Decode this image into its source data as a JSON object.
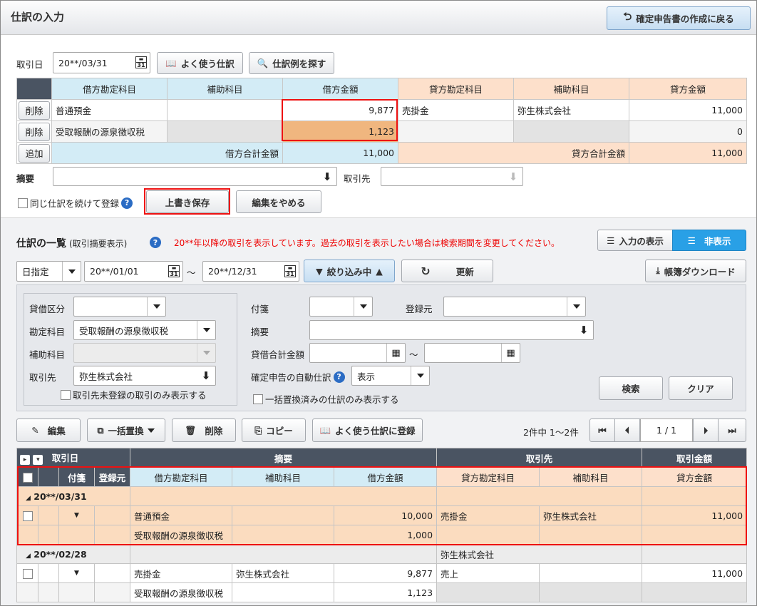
{
  "header": {
    "title": "仕訳の入力",
    "back_button": "確定申告書の作成に戻る"
  },
  "entry": {
    "date_label": "取引日",
    "date_value": "20**/03/31",
    "frequent_btn": "よく使う仕訳",
    "search_example_btn": "仕訳例を探す",
    "headers": [
      "借方勘定科目",
      "補助科目",
      "借方金額",
      "貸方勘定科目",
      "補助科目",
      "貸方金額"
    ],
    "rows": [
      {
        "action": "削除",
        "debit_account": "普通預金",
        "debit_sub": "",
        "debit_amount": "9,877",
        "credit_account": "売掛金",
        "credit_sub": "弥生株式会社",
        "credit_amount": "11,000"
      },
      {
        "action": "削除",
        "debit_account": "受取報酬の源泉徴収税",
        "debit_sub": "",
        "debit_amount": "1,123",
        "credit_account": "",
        "credit_sub": "",
        "credit_amount": "0"
      }
    ],
    "add_btn": "追加",
    "debit_total_label": "借方合計金額",
    "debit_total": "11,000",
    "credit_total_label": "貸方合計金額",
    "credit_total": "11,000",
    "memo_label": "摘要",
    "partner_label": "取引先",
    "continue_label": "同じ仕訳を続けて登録",
    "overwrite_btn": "上書き保存",
    "cancel_btn": "編集をやめる"
  },
  "list": {
    "title": "仕訳の一覧",
    "subtitle": "(取引摘要表示)",
    "notice": "20**年以降の取引を表示しています。過去の取引を表示したい場合は検索期間を変更してください。",
    "toggle_show": "入力の表示",
    "toggle_hide": "非表示",
    "period_mode": "日指定",
    "date_from": "20**/01/01",
    "tilde": "～",
    "date_to": "20**/12/31",
    "filter_btn": "絞り込み中",
    "refresh_btn": "更新",
    "download_btn": "帳簿ダウンロード",
    "filter": {
      "dc_label": "貸借区分",
      "account_label": "勘定科目",
      "account_value": "受取報酬の源泉徴収税",
      "sub_label": "補助科目",
      "partner_label": "取引先",
      "partner_value": "弥生株式会社",
      "unregistered_label": "取引先未登録の取引のみ表示する",
      "tag_label": "付箋",
      "source_label": "登録元",
      "memo_label": "摘要",
      "total_label": "貸借合計金額",
      "auto_label": "確定申告の自動仕訳",
      "auto_value": "表示",
      "bulk_label": "一括置換済みの仕訳のみ表示する",
      "search_btn": "検索",
      "clear_btn": "クリア"
    },
    "actions": {
      "edit": "編集",
      "bulk_replace": "一括置換",
      "delete": "削除",
      "copy": "コピー",
      "register_frequent": "よく使う仕訳に登録"
    },
    "pagination": {
      "count": "2件中 1～2件",
      "page": "1 / 1"
    },
    "columns_top": [
      "取引日",
      "摘要",
      "取引先",
      "取引金額"
    ],
    "columns_sub": [
      "付箋",
      "登録元",
      "借方勘定科目",
      "補助科目",
      "借方金額",
      "貸方勘定科目",
      "補助科目",
      "貸方金額"
    ],
    "groups": [
      {
        "date": "20**/03/31",
        "partner": "",
        "rows": [
          {
            "debit_account": "普通預金",
            "debit_sub": "",
            "debit_amount": "10,000",
            "credit_account": "売掛金",
            "credit_sub": "弥生株式会社",
            "credit_amount": "11,000"
          },
          {
            "debit_account": "受取報酬の源泉徴収税",
            "debit_sub": "",
            "debit_amount": "1,000",
            "credit_account": "",
            "credit_sub": "",
            "credit_amount": ""
          }
        ]
      },
      {
        "date": "20**/02/28",
        "partner": "弥生株式会社",
        "rows": [
          {
            "debit_account": "売掛金",
            "debit_sub": "弥生株式会社",
            "debit_amount": "9,877",
            "credit_account": "売上",
            "credit_sub": "",
            "credit_amount": "11,000"
          },
          {
            "debit_account": "受取報酬の源泉徴収税",
            "debit_sub": "",
            "debit_amount": "1,123",
            "credit_account": "",
            "credit_sub": "",
            "credit_amount": ""
          }
        ]
      }
    ]
  }
}
